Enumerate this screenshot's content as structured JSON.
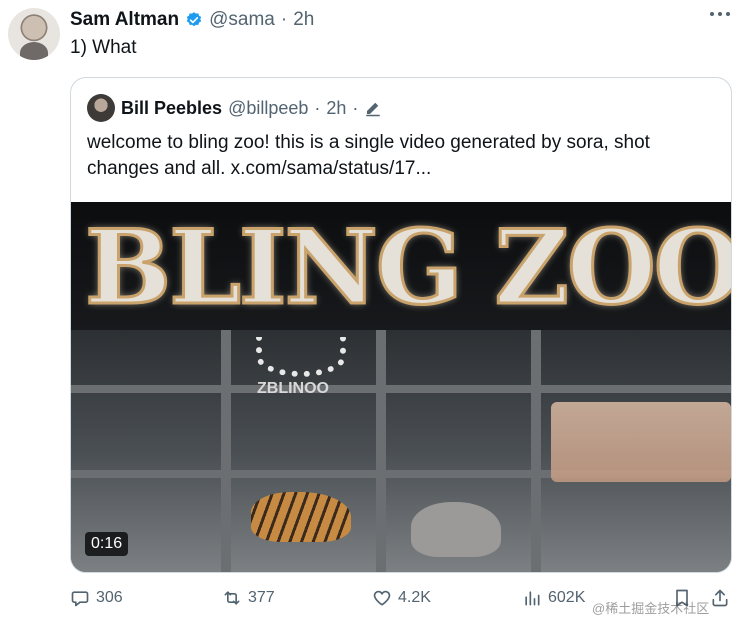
{
  "author": {
    "name": "Sam Altman",
    "handle": "@sama",
    "separator": "·",
    "time": "2h",
    "avatar_icon": "profile-photo-icon",
    "verified_icon": "verified-badge-icon",
    "verified_color": "#1d9bf0"
  },
  "tweet": {
    "text": "1) What"
  },
  "quote": {
    "name": "Bill Peebles",
    "handle": "@billpeeb",
    "separator": "·",
    "time": "2h",
    "separator2": "·",
    "edit_icon": "edit-pencil-icon",
    "text": "welcome to bling zoo! this is a single video generated by sora, shot changes and all.  x.com/sama/status/17...",
    "media": {
      "sign_text": "BLING ZOO",
      "case_label": "ZBLINOO",
      "duration": "0:16"
    }
  },
  "actions": {
    "replies": "306",
    "retweets": "377",
    "likes": "4.2K",
    "views": "602K"
  },
  "watermark": "@稀土掘金技术社区",
  "colors": {
    "muted": "#536471",
    "border": "#cfd9de",
    "text": "#0f1419"
  }
}
